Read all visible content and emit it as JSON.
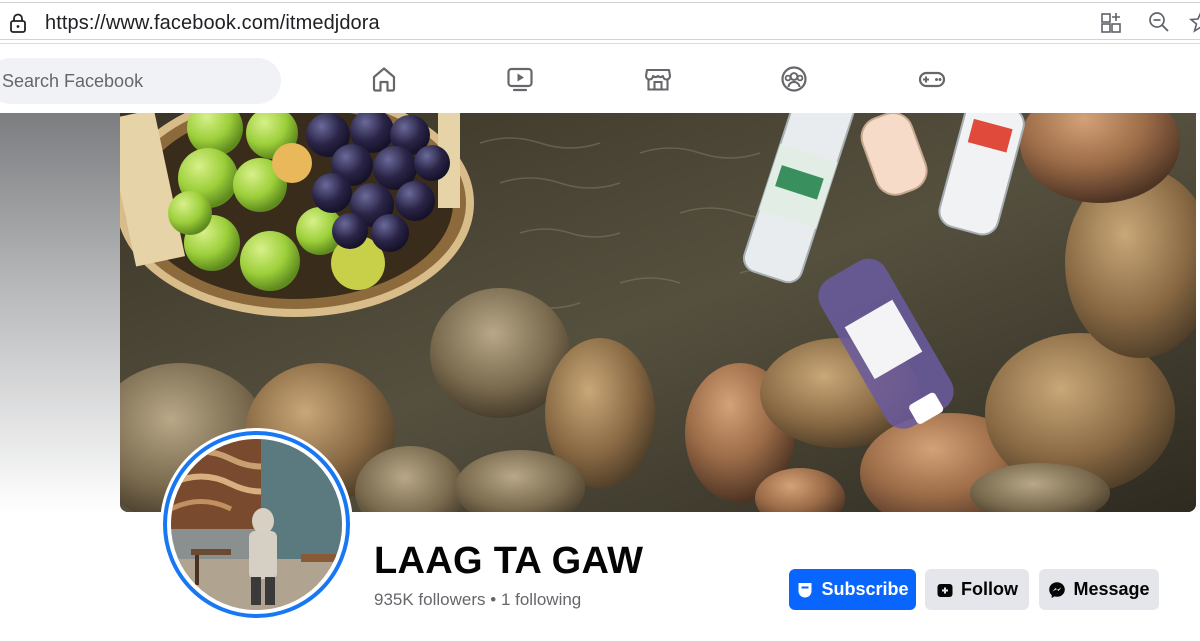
{
  "browser": {
    "url": "https://www.facebook.com/itmedjdora",
    "icons": [
      "lock-icon",
      "add-tab-icon",
      "zoom-out-icon",
      "star-icon"
    ]
  },
  "nav": {
    "search_placeholder": "Search Facebook",
    "tabs": [
      "home-icon",
      "video-icon",
      "marketplace-icon",
      "groups-icon",
      "gaming-icon"
    ]
  },
  "profile": {
    "name": "LAAG TA GAW",
    "followers": "935K followers",
    "separator": "•",
    "following": "1 following"
  },
  "actions": {
    "subscribe_label": "Subscribe",
    "follow_label": "Follow",
    "message_label": "Message"
  },
  "colors": {
    "primary": "#0866ff",
    "avatar_ring": "#1877f2",
    "button_gray": "#e4e6eb",
    "text_secondary": "#65676b"
  }
}
